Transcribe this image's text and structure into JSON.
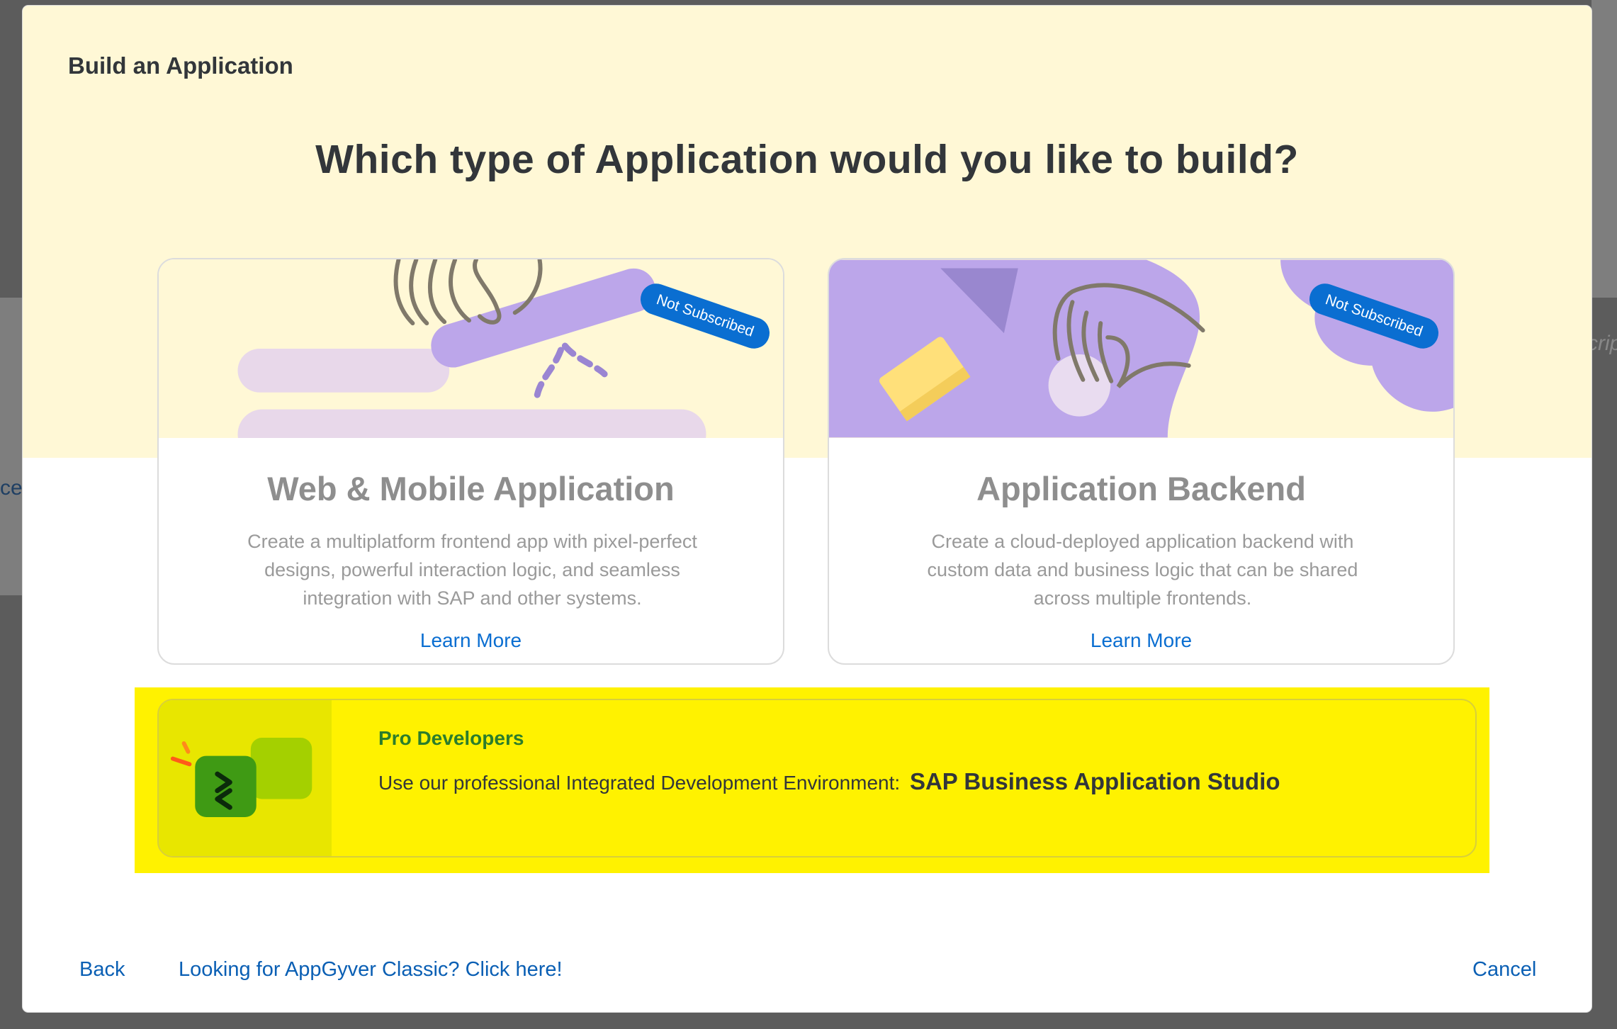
{
  "background": {
    "edge_text_left": "ce",
    "edge_text_right": "crip"
  },
  "dialog": {
    "title": "Build an Application",
    "question": "Which type of Application would you like to build?"
  },
  "cards": [
    {
      "id": "web-mobile",
      "badge": "Not Subscribed",
      "title": "Web & Mobile Application",
      "description": "Create a multiplatform frontend app with pixel-perfect designs, powerful interaction logic, and seamless integration with SAP and other systems.",
      "link": "Learn More"
    },
    {
      "id": "backend",
      "badge": "Not Subscribed",
      "title": "Application Backend",
      "description": "Create a cloud-deployed application backend with custom data and business logic that can be shared across multiple frontends.",
      "link": "Learn More"
    }
  ],
  "pro": {
    "title": "Pro Developers",
    "description": "Use our professional Integrated Development Environment:",
    "product": "SAP Business Application Studio"
  },
  "footer": {
    "back": "Back",
    "classic": "Looking for AppGyver Classic? Click here!",
    "cancel": "Cancel"
  },
  "colors": {
    "hero_background": "#fff8d6",
    "accent_link": "#0a6ed1",
    "badge": "#0a6ed1",
    "illustration_purple": "#bca6ea",
    "pro_highlight": "#fff200",
    "pro_title": "#2b7d2b"
  }
}
